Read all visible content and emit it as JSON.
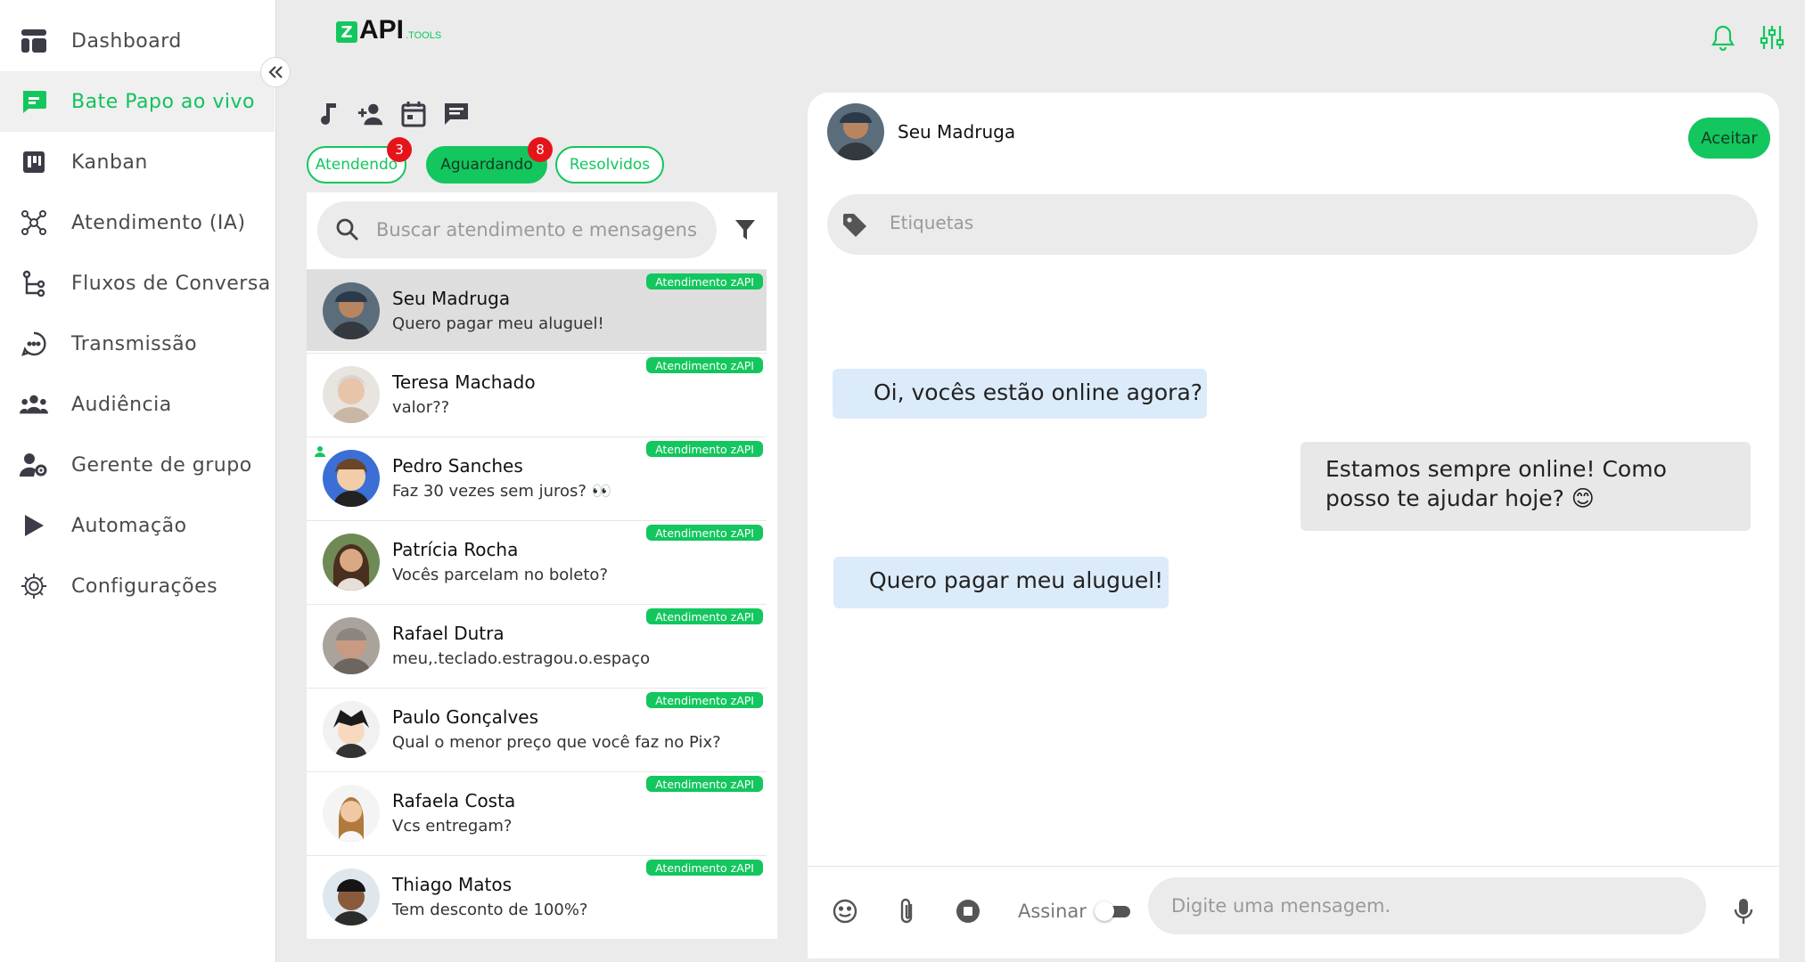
{
  "sidebar": {
    "collapse_icon": "double-chevron-left-icon",
    "items": [
      {
        "label": "Dashboard",
        "icon": "dashboard-icon"
      },
      {
        "label": "Bate Papo ao vivo",
        "icon": "chat-icon",
        "active": true
      },
      {
        "label": "Kanban",
        "icon": "kanban-icon"
      },
      {
        "label": "Atendimento (IA)",
        "icon": "ai-network-icon"
      },
      {
        "label": "Fluxos de Conversa",
        "icon": "flow-icon"
      },
      {
        "label": "Transmissão",
        "icon": "broadcast-icon"
      },
      {
        "label": "Audiência",
        "icon": "audience-icon"
      },
      {
        "label": "Gerente de grupo",
        "icon": "group-manager-icon"
      },
      {
        "label": "Automação",
        "icon": "play-icon"
      },
      {
        "label": "Configurações",
        "icon": "gear-icon"
      }
    ]
  },
  "header": {
    "logo_mark": "Z",
    "logo_text": "API",
    "logo_sub": ".TOOLS",
    "icons": [
      "bell-icon",
      "sliders-icon"
    ]
  },
  "toolbar": {
    "icons": [
      "music-note-icon",
      "add-user-icon",
      "calendar-icon",
      "message-icon"
    ]
  },
  "tabs": [
    {
      "label": "Atendendo",
      "badge": "3",
      "active": false
    },
    {
      "label": "Aguardando",
      "badge": "8",
      "active": true
    },
    {
      "label": "Resolvidos",
      "badge": "",
      "active": false
    }
  ],
  "search": {
    "placeholder": "Buscar atendimento e mensagens",
    "value": ""
  },
  "conversations": [
    {
      "name": "Seu Madruga",
      "preview": "Quero pagar meu aluguel!",
      "tag": "Atendimento zAPI",
      "selected": true
    },
    {
      "name": "Teresa Machado",
      "preview": "valor??",
      "tag": "Atendimento zAPI"
    },
    {
      "name": "Pedro Sanches",
      "preview": "Faz 30 vezes sem juros? 👀",
      "tag": "Atendimento zAPI"
    },
    {
      "name": "Patrícia Rocha",
      "preview": "Vocês parcelam no boleto?",
      "tag": "Atendimento zAPI"
    },
    {
      "name": "Rafael Dutra",
      "preview": "meu,.teclado.estragou.o.espaço",
      "tag": "Atendimento zAPI"
    },
    {
      "name": "Paulo Gonçalves",
      "preview": "Qual o menor preço que você faz no Pix?",
      "tag": "Atendimento zAPI"
    },
    {
      "name": "Rafaela Costa",
      "preview": "Vcs entregam?",
      "tag": "Atendimento zAPI"
    },
    {
      "name": "Thiago Matos",
      "preview": "Tem desconto de 100%?",
      "tag": "Atendimento zAPI"
    }
  ],
  "chat": {
    "contact_name": "Seu Madruga",
    "accept_label": "Aceitar",
    "tags_placeholder": "Etiquetas",
    "messages": [
      {
        "direction": "in",
        "text": "Oi, vocês estão online agora?"
      },
      {
        "direction": "out",
        "text": "Estamos sempre online! Como posso te ajudar hoje? 😊"
      },
      {
        "direction": "in",
        "text": "Quero pagar meu aluguel!"
      }
    ],
    "composer": {
      "sign_label": "Assinar",
      "sign_enabled": false,
      "placeholder": "Digite uma mensagem.",
      "icons": [
        "emoji-icon",
        "paperclip-icon",
        "stop-icon",
        "microphone-icon"
      ]
    }
  },
  "colors": {
    "accent": "#13c65e",
    "badge": "#e5141b",
    "incoming_bubble": "#dcebfa",
    "outgoing_bubble": "#e8e8e8"
  }
}
